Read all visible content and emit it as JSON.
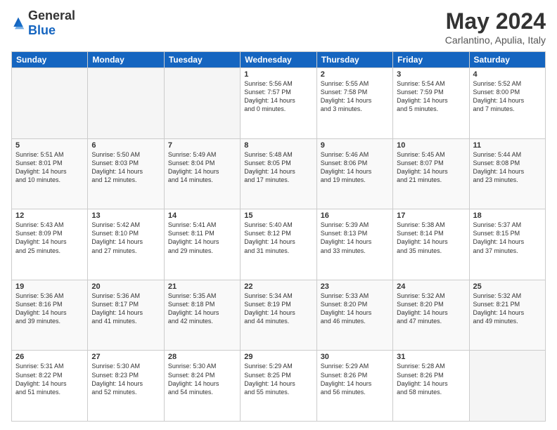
{
  "logo": {
    "general": "General",
    "blue": "Blue"
  },
  "header": {
    "month": "May 2024",
    "location": "Carlantino, Apulia, Italy"
  },
  "weekdays": [
    "Sunday",
    "Monday",
    "Tuesday",
    "Wednesday",
    "Thursday",
    "Friday",
    "Saturday"
  ],
  "weeks": [
    [
      {
        "day": "",
        "info": ""
      },
      {
        "day": "",
        "info": ""
      },
      {
        "day": "",
        "info": ""
      },
      {
        "day": "1",
        "info": "Sunrise: 5:56 AM\nSunset: 7:57 PM\nDaylight: 14 hours\nand 0 minutes."
      },
      {
        "day": "2",
        "info": "Sunrise: 5:55 AM\nSunset: 7:58 PM\nDaylight: 14 hours\nand 3 minutes."
      },
      {
        "day": "3",
        "info": "Sunrise: 5:54 AM\nSunset: 7:59 PM\nDaylight: 14 hours\nand 5 minutes."
      },
      {
        "day": "4",
        "info": "Sunrise: 5:52 AM\nSunset: 8:00 PM\nDaylight: 14 hours\nand 7 minutes."
      }
    ],
    [
      {
        "day": "5",
        "info": "Sunrise: 5:51 AM\nSunset: 8:01 PM\nDaylight: 14 hours\nand 10 minutes."
      },
      {
        "day": "6",
        "info": "Sunrise: 5:50 AM\nSunset: 8:03 PM\nDaylight: 14 hours\nand 12 minutes."
      },
      {
        "day": "7",
        "info": "Sunrise: 5:49 AM\nSunset: 8:04 PM\nDaylight: 14 hours\nand 14 minutes."
      },
      {
        "day": "8",
        "info": "Sunrise: 5:48 AM\nSunset: 8:05 PM\nDaylight: 14 hours\nand 17 minutes."
      },
      {
        "day": "9",
        "info": "Sunrise: 5:46 AM\nSunset: 8:06 PM\nDaylight: 14 hours\nand 19 minutes."
      },
      {
        "day": "10",
        "info": "Sunrise: 5:45 AM\nSunset: 8:07 PM\nDaylight: 14 hours\nand 21 minutes."
      },
      {
        "day": "11",
        "info": "Sunrise: 5:44 AM\nSunset: 8:08 PM\nDaylight: 14 hours\nand 23 minutes."
      }
    ],
    [
      {
        "day": "12",
        "info": "Sunrise: 5:43 AM\nSunset: 8:09 PM\nDaylight: 14 hours\nand 25 minutes."
      },
      {
        "day": "13",
        "info": "Sunrise: 5:42 AM\nSunset: 8:10 PM\nDaylight: 14 hours\nand 27 minutes."
      },
      {
        "day": "14",
        "info": "Sunrise: 5:41 AM\nSunset: 8:11 PM\nDaylight: 14 hours\nand 29 minutes."
      },
      {
        "day": "15",
        "info": "Sunrise: 5:40 AM\nSunset: 8:12 PM\nDaylight: 14 hours\nand 31 minutes."
      },
      {
        "day": "16",
        "info": "Sunrise: 5:39 AM\nSunset: 8:13 PM\nDaylight: 14 hours\nand 33 minutes."
      },
      {
        "day": "17",
        "info": "Sunrise: 5:38 AM\nSunset: 8:14 PM\nDaylight: 14 hours\nand 35 minutes."
      },
      {
        "day": "18",
        "info": "Sunrise: 5:37 AM\nSunset: 8:15 PM\nDaylight: 14 hours\nand 37 minutes."
      }
    ],
    [
      {
        "day": "19",
        "info": "Sunrise: 5:36 AM\nSunset: 8:16 PM\nDaylight: 14 hours\nand 39 minutes."
      },
      {
        "day": "20",
        "info": "Sunrise: 5:36 AM\nSunset: 8:17 PM\nDaylight: 14 hours\nand 41 minutes."
      },
      {
        "day": "21",
        "info": "Sunrise: 5:35 AM\nSunset: 8:18 PM\nDaylight: 14 hours\nand 42 minutes."
      },
      {
        "day": "22",
        "info": "Sunrise: 5:34 AM\nSunset: 8:19 PM\nDaylight: 14 hours\nand 44 minutes."
      },
      {
        "day": "23",
        "info": "Sunrise: 5:33 AM\nSunset: 8:20 PM\nDaylight: 14 hours\nand 46 minutes."
      },
      {
        "day": "24",
        "info": "Sunrise: 5:32 AM\nSunset: 8:20 PM\nDaylight: 14 hours\nand 47 minutes."
      },
      {
        "day": "25",
        "info": "Sunrise: 5:32 AM\nSunset: 8:21 PM\nDaylight: 14 hours\nand 49 minutes."
      }
    ],
    [
      {
        "day": "26",
        "info": "Sunrise: 5:31 AM\nSunset: 8:22 PM\nDaylight: 14 hours\nand 51 minutes."
      },
      {
        "day": "27",
        "info": "Sunrise: 5:30 AM\nSunset: 8:23 PM\nDaylight: 14 hours\nand 52 minutes."
      },
      {
        "day": "28",
        "info": "Sunrise: 5:30 AM\nSunset: 8:24 PM\nDaylight: 14 hours\nand 54 minutes."
      },
      {
        "day": "29",
        "info": "Sunrise: 5:29 AM\nSunset: 8:25 PM\nDaylight: 14 hours\nand 55 minutes."
      },
      {
        "day": "30",
        "info": "Sunrise: 5:29 AM\nSunset: 8:26 PM\nDaylight: 14 hours\nand 56 minutes."
      },
      {
        "day": "31",
        "info": "Sunrise: 5:28 AM\nSunset: 8:26 PM\nDaylight: 14 hours\nand 58 minutes."
      },
      {
        "day": "",
        "info": ""
      }
    ]
  ]
}
